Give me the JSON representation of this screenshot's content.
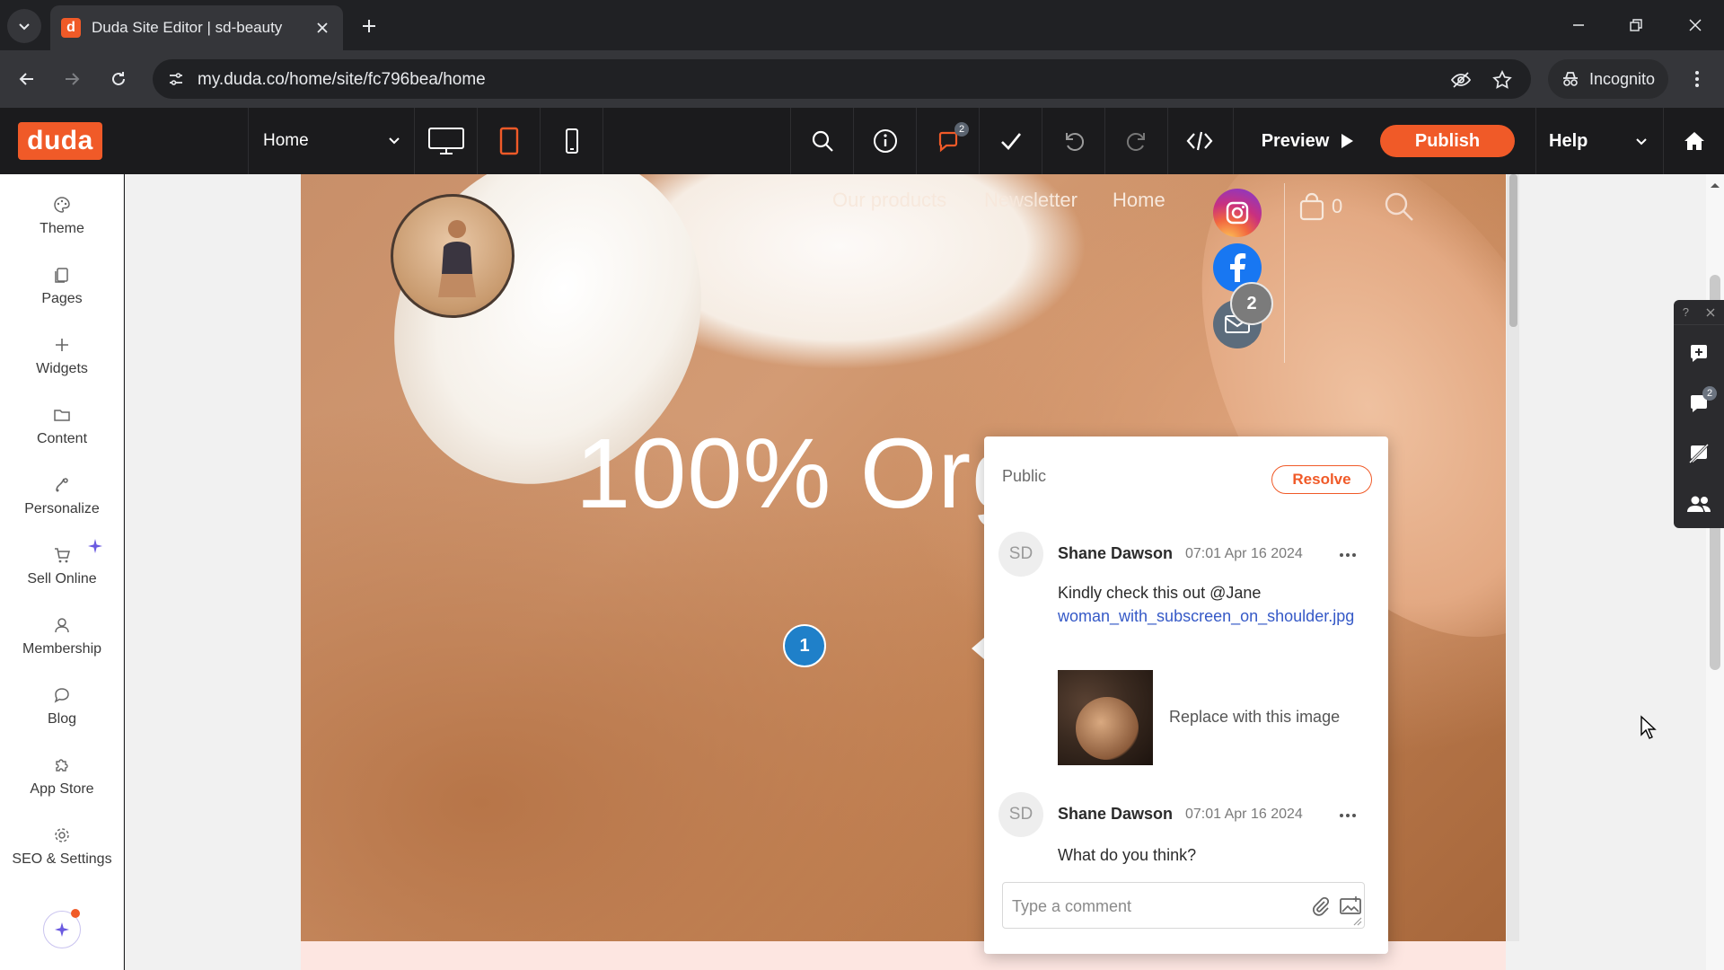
{
  "browser": {
    "tab_title": "Duda Site Editor | sd-beauty",
    "favicon_letter": "d",
    "url": "my.duda.co/home/site/fc796bea/home",
    "incognito_label": "Incognito"
  },
  "editor": {
    "logo": "duda",
    "page_selector": "Home",
    "comments_badge": "2",
    "preview_label": "Preview",
    "publish_label": "Publish",
    "help_label": "Help",
    "accent_color": "#f05a28"
  },
  "sidebar": {
    "items": [
      {
        "label": "Theme",
        "icon": "palette-icon"
      },
      {
        "label": "Pages",
        "icon": "pages-icon"
      },
      {
        "label": "Widgets",
        "icon": "plus-icon"
      },
      {
        "label": "Content",
        "icon": "folder-icon"
      },
      {
        "label": "Personalize",
        "icon": "personalize-icon"
      },
      {
        "label": "Sell Online",
        "icon": "cart-icon"
      },
      {
        "label": "Membership",
        "icon": "user-icon"
      },
      {
        "label": "Blog",
        "icon": "chat-bubble-icon"
      },
      {
        "label": "App Store",
        "icon": "puzzle-icon"
      },
      {
        "label": "SEO & Settings",
        "icon": "gear-icon"
      }
    ]
  },
  "site": {
    "nav": [
      "Our products",
      "Newsletter",
      "Home"
    ],
    "cart_count": "0",
    "hero_text": "100% Org"
  },
  "markers": {
    "first": "1",
    "second": "2"
  },
  "floating_panel": {
    "help": "?",
    "comments_badge": "2"
  },
  "comment_thread": {
    "visibility": "Public",
    "resolve_label": "Resolve",
    "comments": [
      {
        "initials": "SD",
        "author": "Shane Dawson",
        "time": "07:01 Apr 16 2024",
        "text": "Kindly check this out @Jane",
        "attachment": "woman_with_subscreen_on_shoulder.jpg",
        "image_note": "Replace with this image"
      },
      {
        "initials": "SD",
        "author": "Shane Dawson",
        "time": "07:01 Apr 16 2024",
        "text": "What do you think?"
      }
    ],
    "input_placeholder": "Type a comment"
  }
}
